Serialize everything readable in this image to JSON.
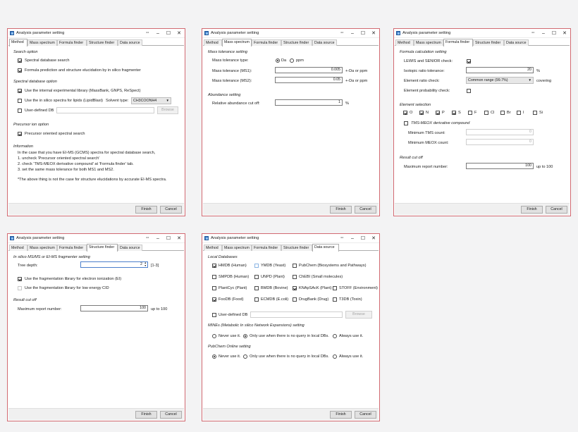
{
  "window_title": "Analysis parameter setting",
  "titlebar_icons": {
    "restore": "⁴⁴",
    "minimize": "–",
    "maximize": "☐",
    "close": "✕"
  },
  "tabs": [
    "Method",
    "Mass spectrum",
    "Formula finder",
    "Structure finder",
    "Data source"
  ],
  "buttons": {
    "finish": "Finish",
    "cancel": "Cancel",
    "browse": "Browse"
  },
  "method": {
    "search_option": "Search option",
    "spectral_db_search": "Spectral database search",
    "formula_prediction": "Formula prediction and structure elucidation by in silico fragmenter",
    "spectral_db_option": "Spectral database option",
    "internal_library": "Use the internal experimental library (MassBank, GNPS, ReSpect)",
    "lipidblast": "Use the in silico spectra for lipids (LipidBlast)",
    "solvent_type_label": "Solvent type:",
    "solvent_type_value": "CH3COONH4",
    "user_defined_db": "User-defined DB",
    "precursor_ion_option": "Precursor ion option",
    "precursor_oriented": "Precursor oriented spectral search",
    "information": "Information",
    "info_line1": "In the case that you have EI-MS (GCMS) spectra for spectral database search,",
    "info_line2": "1. uncheck 'Precursor oriented spectral search'",
    "info_line3": "2. check 'TMS-MEOX derivative compound' at 'Formula finder' tab.",
    "info_line4": "3. set the same mass tolerance for both MS1 and MS2.",
    "info_note": "*The above thing is not the case for structure elucidations by accurate EI-MS spectra."
  },
  "mass": {
    "mass_tolerance_setting": "Mass tolerance setting",
    "mass_tolerance_type": "Mass tolerance type:",
    "da": "Da",
    "ppm": "ppm",
    "ms1_label": "Mass tolerance (MS1):",
    "ms1_value": "0.005",
    "ms2_label": "Mass tolerance (MS2):",
    "ms2_value": "0.05",
    "unit": "+-Da or ppm",
    "abundance_setting": "Abundance setting",
    "rel_abundance_label": "Relative abundance cut off:",
    "rel_abundance_value": "1",
    "percent": "%"
  },
  "formula": {
    "calc_setting": "Formula calculation setting",
    "lewis_senior": "LEWIS and SENIOR check:",
    "isotopic_ratio_label": "Isotopic ratio tolerance:",
    "isotopic_ratio_value": "20",
    "percent": "%",
    "element_ratio_label": "Element ratio check:",
    "element_ratio_value": "Common range (99.7%)",
    "covering": "covering",
    "element_probability": "Element probability check:",
    "element_selection": "Element selection",
    "elements": [
      "O",
      "N",
      "P",
      "S",
      "F",
      "Cl",
      "Br",
      "I",
      "Si"
    ],
    "elements_checked": [
      true,
      true,
      true,
      true,
      false,
      false,
      false,
      false,
      false
    ],
    "tms_meox": "TMS-MEOX derivative compound",
    "min_tms_label": "Minimum TMS count:",
    "min_tms_value": "0",
    "min_meox_label": "Minimum MEOX count:",
    "min_meox_value": "0",
    "result_cut_off": "Result cut off",
    "max_report_label": "Maximum report number:",
    "max_report_value": "100",
    "up_to": "up to 100"
  },
  "structure": {
    "setting": "In silico MS/MS or EI-MS fragmenter setting",
    "tree_depth_label": "Tree depth:",
    "tree_depth_value": "2",
    "tree_depth_range": "[1-3]",
    "ei_library": "Use the fragmentation library for electron ionization (EI)",
    "low_energy": "Use the fragmentation library for low energy CID",
    "result_cut_off": "Result cut off",
    "max_report_label": "Maximum report number:",
    "max_report_value": "100",
    "up_to": "up to 100"
  },
  "datasource": {
    "local_databases": "Local Databases",
    "dbs": [
      {
        "name": "HMDB (Human)",
        "checked": true
      },
      {
        "name": "YMDB (Yeast)",
        "checked": false
      },
      {
        "name": "PubChem (Biosystems and Pathways)",
        "checked": false
      },
      {
        "name": "SMPDB (Human)",
        "checked": false
      },
      {
        "name": "UNPD (Plant)",
        "checked": false
      },
      {
        "name": "ChEBI (Small molecules)",
        "checked": false
      },
      {
        "name": "PlantCyc (Plant)",
        "checked": false
      },
      {
        "name": "BMDB (Bovine)",
        "checked": false
      },
      {
        "name": "KNApSAcK (Plant)",
        "checked": true
      },
      {
        "name": "STOFF (Environment)",
        "checked": false
      },
      {
        "name": "FooDB (Food)",
        "checked": true
      },
      {
        "name": "ECMDB (E.coli)",
        "checked": false
      },
      {
        "name": "DrugBank (Drug)",
        "checked": false
      },
      {
        "name": "T3DB (Toxin)",
        "checked": false
      }
    ],
    "user_defined_db": "User-defined DB",
    "mines_setting": "MINEs (Metabolic In silico Network Expansions) setting",
    "never_use": "Never use it.",
    "only_use": "Only use when there is no query in local DBs.",
    "always_use": "Always use it.",
    "pubchem_setting": "PubChem Online setting"
  }
}
